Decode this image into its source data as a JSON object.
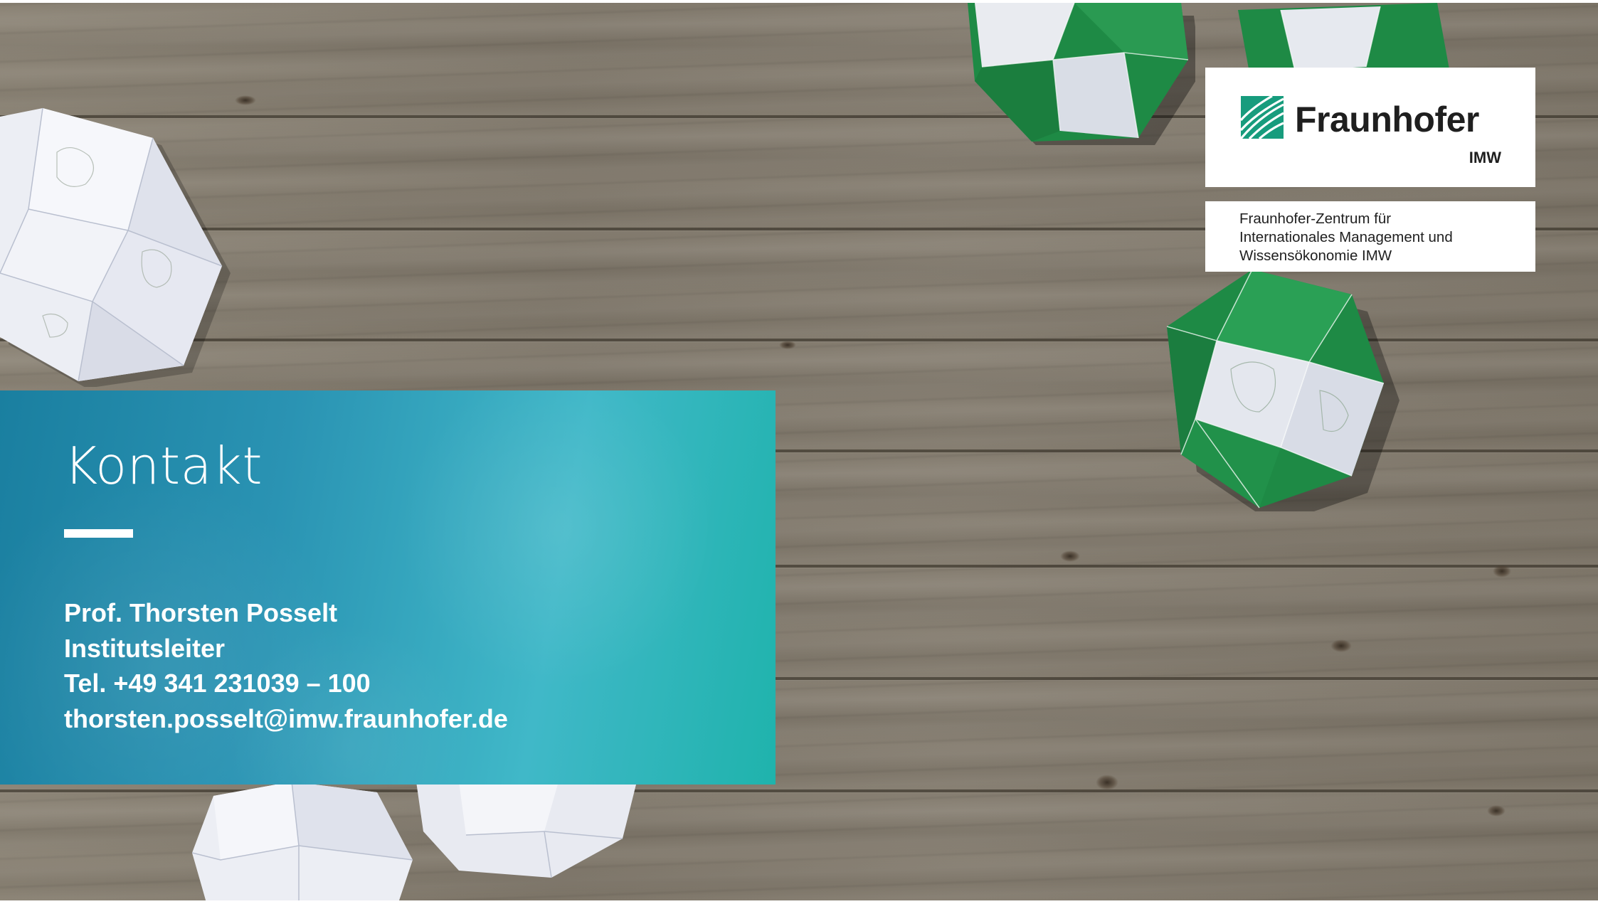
{
  "slide": {
    "title": "Kontakt"
  },
  "contact": {
    "name": "Prof. Thorsten Posselt",
    "role": "Institutsleiter",
    "phone": "Tel. +49 341 231039 – 100",
    "email": "thorsten.posselt@imw.fraunhofer.de"
  },
  "logo": {
    "name": "Fraunhofer",
    "unit": "IMW",
    "icon": "fraunhofer-stripes-icon",
    "color": "#179c7d"
  },
  "institute": {
    "lines": [
      "Fraunhofer-Zentrum für",
      "Internationales Management und",
      "Wissensökonomie IMW"
    ]
  },
  "colors": {
    "contact_box_start": "#1a7fa0",
    "contact_box_end": "#1fb3ac",
    "globe_green": "#1e8a45",
    "text_on_box": "#ffffff"
  }
}
